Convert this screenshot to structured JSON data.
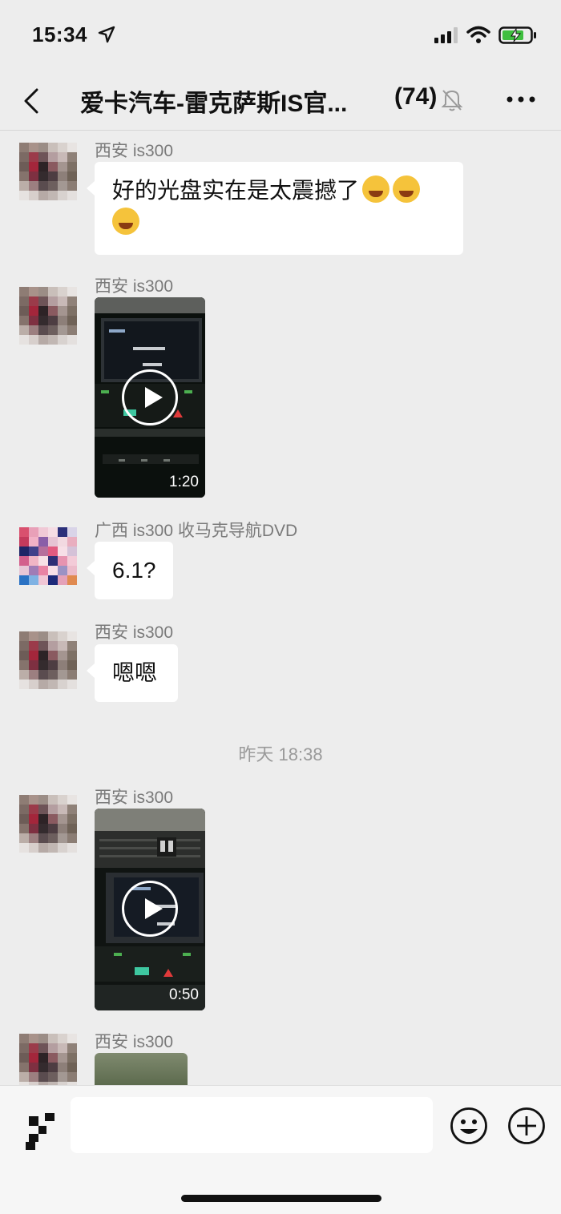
{
  "status_bar": {
    "time": "15:34"
  },
  "header": {
    "title": "爱卡汽车-雷克萨斯IS官...",
    "member_count": "(74)"
  },
  "messages": [
    {
      "sender": "西安 is300",
      "type": "text",
      "text": "好的光盘实在是太震撼了"
    },
    {
      "sender": "西安 is300",
      "type": "video",
      "duration": "1:20"
    },
    {
      "sender": "广西 is300 收马克导航DVD",
      "type": "text",
      "text": "6.1?"
    },
    {
      "sender": "西安 is300",
      "type": "text",
      "text": "嗯嗯"
    },
    {
      "sender": "西安 is300",
      "type": "video",
      "duration": "0:50"
    },
    {
      "sender": "西安 is300",
      "type": "image"
    }
  ],
  "timestamp": "昨天 18:38",
  "input": {
    "value": ""
  },
  "colors": {
    "background": "#ededed",
    "bubble": "#ffffff",
    "sender": "#7a7a7a",
    "timestamp": "#9a9a9a"
  },
  "icons": [
    "location-arrow-icon",
    "signal-icon",
    "wifi-icon",
    "battery-charging-icon",
    "back-chevron-icon",
    "mute-bell-icon",
    "more-dots-icon",
    "play-icon",
    "voice-icon",
    "emoji-face-icon",
    "plus-circle-icon"
  ]
}
